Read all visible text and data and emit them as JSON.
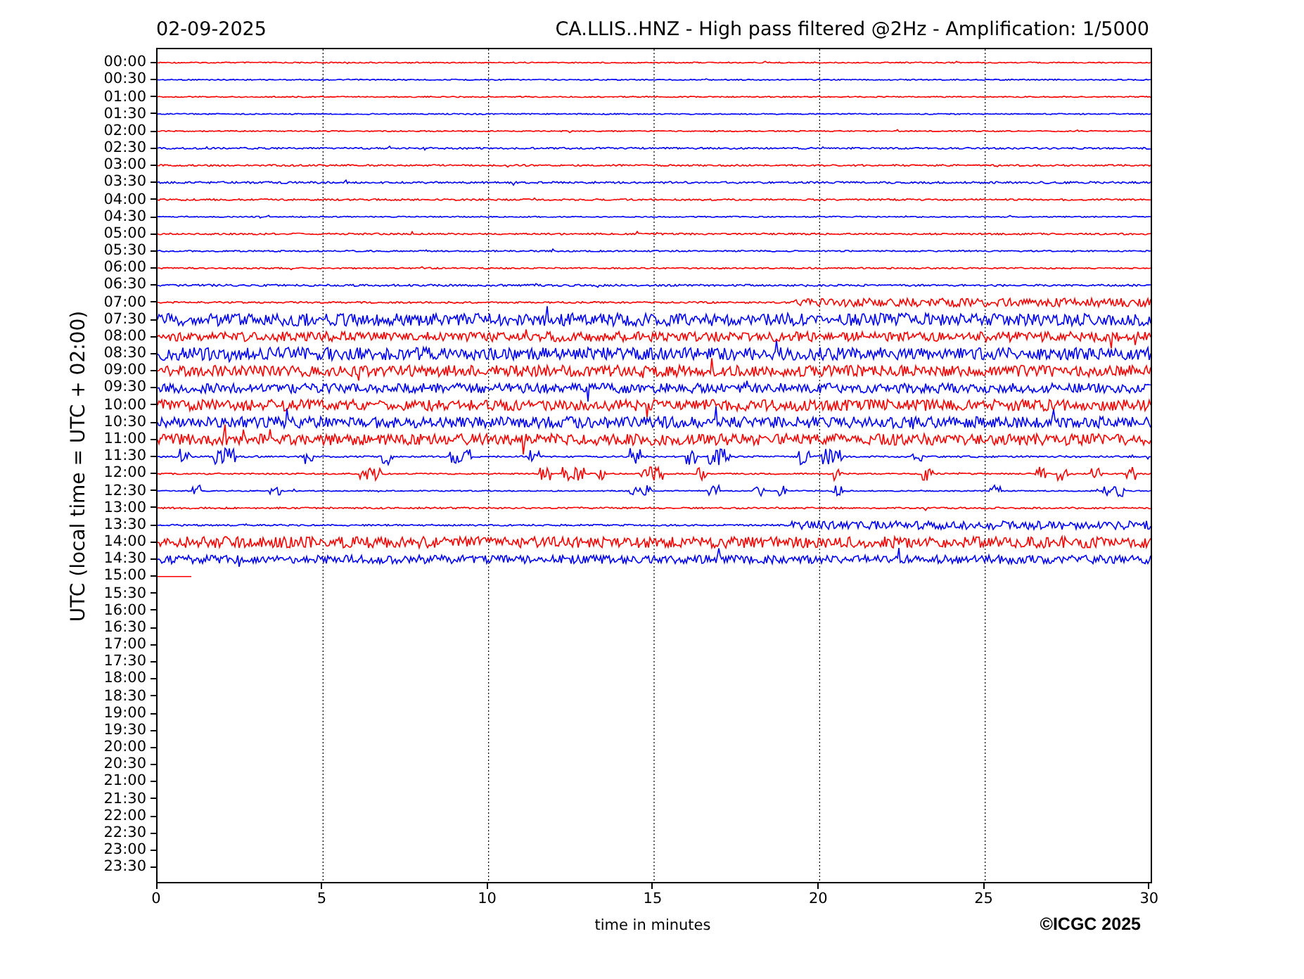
{
  "header": {
    "date": "02-09-2025",
    "title": "CA.LLIS..HNZ - High pass filtered @2Hz - Amplification: 1/5000"
  },
  "y_axis": {
    "label": "UTC (local time = UTC + 02:00)",
    "ticks": [
      "00:00",
      "00:30",
      "01:00",
      "01:30",
      "02:00",
      "02:30",
      "03:00",
      "03:30",
      "04:00",
      "04:30",
      "05:00",
      "05:30",
      "06:00",
      "06:30",
      "07:00",
      "07:30",
      "08:00",
      "08:30",
      "09:00",
      "09:30",
      "10:00",
      "10:30",
      "11:00",
      "11:30",
      "12:00",
      "12:30",
      "13:00",
      "13:30",
      "14:00",
      "14:30",
      "15:00",
      "15:30",
      "16:00",
      "16:30",
      "17:00",
      "17:30",
      "18:00",
      "18:30",
      "19:00",
      "19:30",
      "20:00",
      "20:30",
      "21:00",
      "21:30",
      "22:00",
      "22:30",
      "23:00",
      "23:30"
    ]
  },
  "x_axis": {
    "label": "time in minutes",
    "ticks": [
      "0",
      "5",
      "10",
      "15",
      "20",
      "25",
      "30"
    ]
  },
  "copyright": "©ICGC 2025"
}
